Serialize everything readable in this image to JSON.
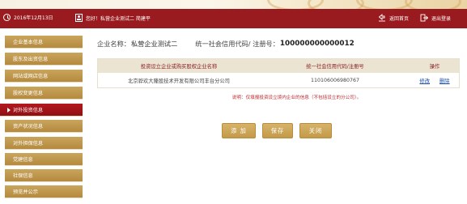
{
  "header": {
    "date": "2016年12月13日",
    "user_info": "您好！私营企业测试二   简建平",
    "home_label": "返回首页",
    "logout_label": "退出登录"
  },
  "sidebar": {
    "items": [
      {
        "label": "企业基本信息",
        "active": false
      },
      {
        "label": "股东及出资信息",
        "active": false
      },
      {
        "label": "网站或网店信息",
        "active": false
      },
      {
        "label": "股权变更信息",
        "active": false
      },
      {
        "label": "对外投资信息",
        "active": true
      },
      {
        "label": "资产状况信息",
        "active": false
      },
      {
        "label": "对外担保信息",
        "active": false
      },
      {
        "label": "党建信息",
        "active": false
      },
      {
        "label": "社保信息",
        "active": false
      },
      {
        "label": "预览并公示",
        "active": false
      }
    ]
  },
  "company": {
    "name_label": "企业名称：",
    "name_value": "私营企业测试二",
    "code_label": "统一社会信用代码/ 注册号：",
    "code_value": "100000000000012"
  },
  "table": {
    "headers": [
      "投资设立企业或购买股权企业名称",
      "统一社会信用代码/注册号",
      "操作"
    ],
    "rows": [
      {
        "name": "北京骅欢大隆股技术开发有限公司丰台分公司",
        "code": "110106006980767",
        "edit": "修改",
        "delete": "删除"
      }
    ]
  },
  "note": "说明：仅填报投资设立境内企业的信息（不包括设立的分公司）。",
  "buttons": {
    "add": "添 加",
    "save": "保存",
    "close": "关闭"
  },
  "colors": {
    "header_bg": "#9a1b1f",
    "menu_gold": "#b48a3e",
    "menu_active": "#9a1014",
    "table_head_bg": "#ece4d2",
    "link_blue": "#1f4fa0",
    "note_red": "#c0282d"
  },
  "icons": {
    "date": "clock-icon",
    "user": "user-icon",
    "home": "home-icon",
    "logout": "exit-icon"
  }
}
